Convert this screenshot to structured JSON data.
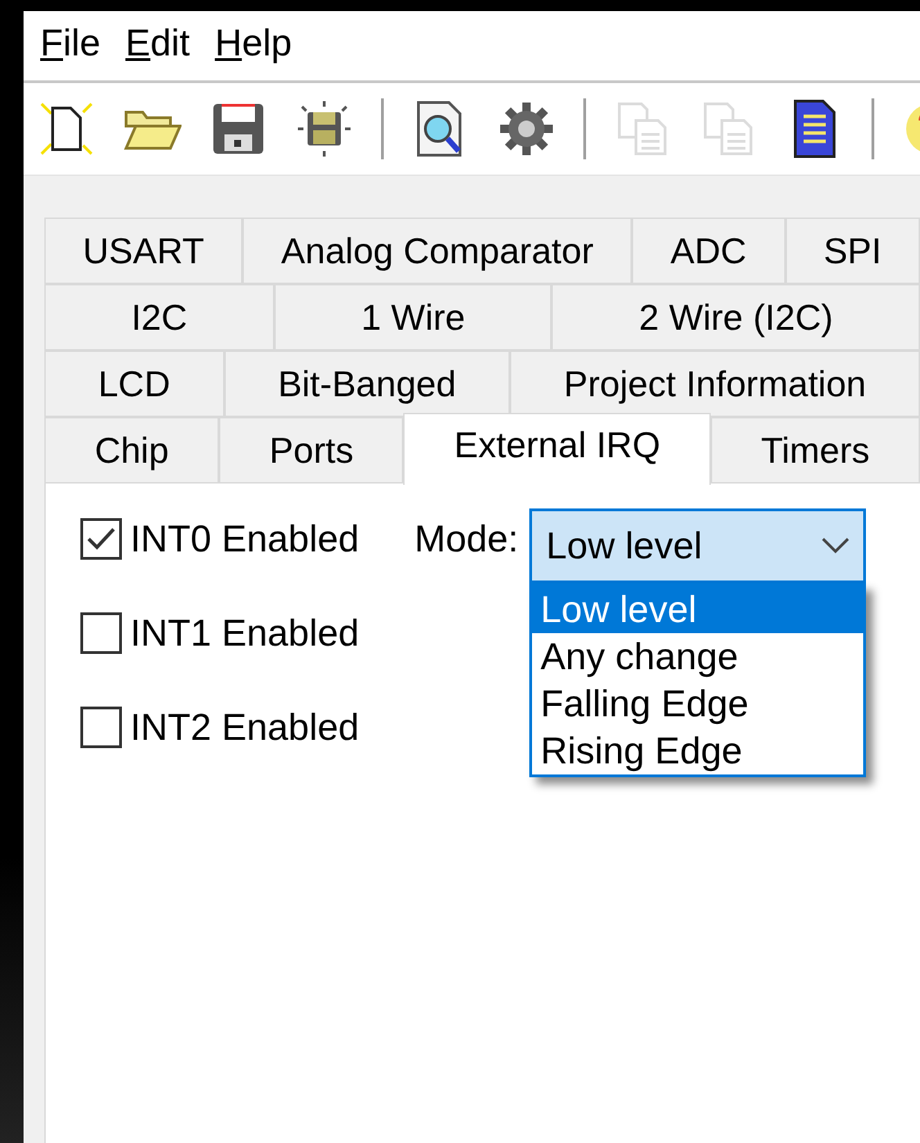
{
  "menu": [
    {
      "label": "File"
    },
    {
      "label": "Edit"
    },
    {
      "label": "Help"
    }
  ],
  "toolbar": [
    {
      "kind": "new",
      "disabled": false
    },
    {
      "kind": "open",
      "disabled": false
    },
    {
      "kind": "save",
      "disabled": false
    },
    {
      "kind": "saveas",
      "disabled": false
    },
    {
      "kind": "separator"
    },
    {
      "kind": "preview",
      "disabled": false
    },
    {
      "kind": "generate",
      "disabled": false
    },
    {
      "kind": "separator"
    },
    {
      "kind": "copy",
      "disabled": true
    },
    {
      "kind": "copy",
      "disabled": true
    },
    {
      "kind": "document",
      "disabled": false
    },
    {
      "kind": "separator"
    },
    {
      "kind": "help",
      "disabled": false
    }
  ],
  "tab_rows": [
    [
      {
        "label": "USART",
        "selected": false
      },
      {
        "label": "Analog Comparator",
        "selected": false
      },
      {
        "label": "ADC",
        "selected": false
      },
      {
        "label": "SPI",
        "selected": false
      }
    ],
    [
      {
        "label": "I2C",
        "selected": false
      },
      {
        "label": "1 Wire",
        "selected": false
      },
      {
        "label": "2 Wire (I2C)",
        "selected": false
      }
    ],
    [
      {
        "label": "LCD",
        "selected": false
      },
      {
        "label": "Bit-Banged",
        "selected": false
      },
      {
        "label": "Project Information",
        "selected": false
      }
    ],
    [
      {
        "label": "Chip",
        "selected": false
      },
      {
        "label": "Ports",
        "selected": false
      },
      {
        "label": "External IRQ",
        "selected": true
      },
      {
        "label": "Timers",
        "selected": false
      }
    ]
  ],
  "interrupts": [
    {
      "label": "INT0 Enabled",
      "checked": true
    },
    {
      "label": "INT1 Enabled",
      "checked": false
    },
    {
      "label": "INT2 Enabled",
      "checked": false
    }
  ],
  "mode": {
    "label": "Mode:",
    "value": "Low level",
    "expanded": true,
    "options": [
      {
        "label": "Low level",
        "selected": true
      },
      {
        "label": "Any change",
        "selected": false
      },
      {
        "label": "Falling Edge",
        "selected": false
      },
      {
        "label": "Rising Edge",
        "selected": false
      }
    ]
  }
}
